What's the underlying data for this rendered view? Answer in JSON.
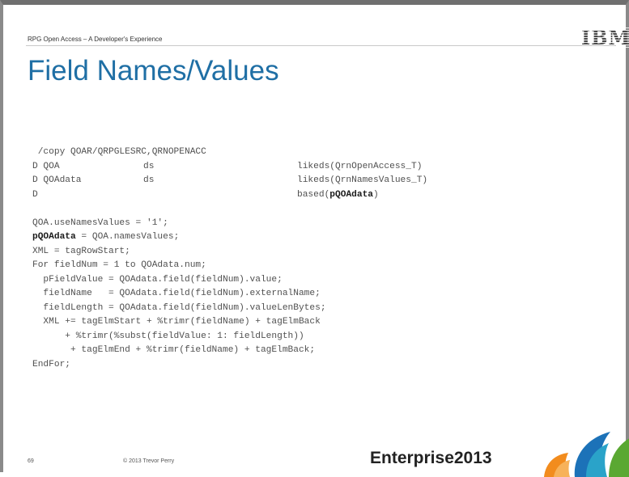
{
  "slide": {
    "header": "RPG Open Access – A Developer's Experience",
    "brand": "IBM",
    "title": "Field Names/Values",
    "page_number": "69",
    "copyright": "© 2013 Trevor Perry",
    "event_name": "Enterprise",
    "event_year": "2013"
  },
  "code": {
    "copy_line": "/copy QOAR/QRPGLESRC,QRNOPENACC",
    "decls": [
      {
        "spec": "D QOA",
        "type": "ds",
        "kw_prefix": "likeds(QrnOpenAccess_T)",
        "kw_bold": "",
        "kw_suffix": ""
      },
      {
        "spec": "D QOAdata",
        "type": "ds",
        "kw_prefix": "likeds(QrnNamesValues_T)",
        "kw_bold": "",
        "kw_suffix": ""
      },
      {
        "spec": "D",
        "type": "",
        "kw_prefix": "based(",
        "kw_bold": "pQOAdata",
        "kw_suffix": ")"
      }
    ],
    "use_names": "QOA.useNamesValues = '1';",
    "ptr_bold": "pQOAdata",
    "ptr_rest": " = QOA.namesValues;",
    "xml_start": "XML = tagRowStart;",
    "for_line": "For fieldNum = 1 to QOAdata.num;",
    "body": [
      "  pFieldValue = QOAdata.field(fieldNum).value;",
      "  fieldName   = QOAdata.field(fieldNum).externalName;",
      "  fieldLength = QOAdata.field(fieldNum).valueLenBytes;",
      "  XML += tagElmStart + %trimr(fieldName) + tagElmBack",
      "      + %trimr(%subst(fieldValue: 1: fieldLength))",
      "       + tagElmEnd + %trimr(fieldName) + tagElmBack;"
    ],
    "endfor": "EndFor;"
  },
  "colors": {
    "title": "#1f6fa5",
    "frame": "#8a8a8a",
    "logo_orange": "#f28c1e",
    "logo_blue": "#1c72b8",
    "logo_green": "#5aa832"
  },
  "icons": [
    "ibm-logo",
    "enterprise-globe-icon"
  ]
}
